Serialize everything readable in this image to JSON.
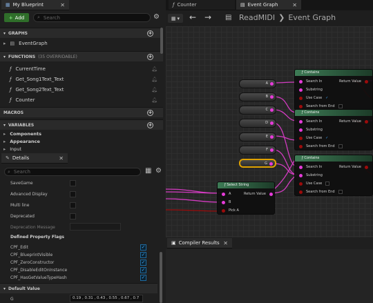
{
  "left_tabs": {
    "blueprint_tab": "My Blueprint",
    "close": "✕"
  },
  "toolbar": {
    "add_label": "Add",
    "search_placeholder": "Search"
  },
  "sections": {
    "graphs": "GRAPHS",
    "functions": "FUNCTIONS",
    "functions_sub": "(35 OVERRIDABLE)",
    "macros": "MACROS",
    "variables": "VARIABLES"
  },
  "graphs_items": [
    "EventGraph"
  ],
  "functions": [
    "CurrentTime",
    "Get_Song1Text_Text",
    "Get_Song2Text_Text",
    "Counter"
  ],
  "variables": [
    "Components",
    "Appearance",
    "Input"
  ],
  "details": {
    "tab": "Details",
    "search_placeholder": "Search",
    "props": [
      "SaveGame",
      "Advanced Display",
      "Multi line",
      "Deprecated"
    ],
    "deprecation_message": "Deprecation Message",
    "defined_flags": "Defined Property Flags",
    "flags": [
      "CPF_Edit",
      "CPF_BlueprintVisible",
      "CPF_ZeroConstructor",
      "CPF_DisableEditOnInstance",
      "CPF_HasGetValueTypeHash"
    ],
    "default_value_header": "Default Value",
    "g_label": "G",
    "g_value": "0.19 , 0.31 , 0.43 , 0.55 , 0.67 , 0.7"
  },
  "editor_tabs": {
    "counter": "Counter",
    "event_graph": "Event Graph",
    "close": "✕"
  },
  "breadcrumb": {
    "root": "ReadMIDI",
    "sep": "❯",
    "current": "Event Graph"
  },
  "graph": {
    "letters": [
      "A",
      "B",
      "C",
      "D",
      "E",
      "F",
      "G"
    ],
    "contains_nodes": [
      {
        "title": "Contains",
        "in": "Search In",
        "sub": "Substring",
        "case": "Use Case",
        "end": "Search from End",
        "ret": "Return Value"
      },
      {
        "title": "Contains",
        "in": "Search In",
        "sub": "Substring",
        "case": "Use Case",
        "end": "Search from End",
        "ret": "Return Value"
      },
      {
        "title": "Contains",
        "in": "Search In",
        "sub": "Substring",
        "case": "Use Case",
        "end": "Search from End",
        "ret": "Return Value"
      }
    ],
    "select_node": {
      "title": "Select String",
      "a": "A",
      "b": "B",
      "pick": "Pick A",
      "ret": "Return Value"
    }
  },
  "compiler": {
    "tab": "Compiler Results",
    "close": "✕"
  },
  "colors": {
    "accent": "#e53bd8",
    "node_header": "#3d7b55",
    "add_button": "#2f6e2a",
    "selected": "#e0a200"
  }
}
